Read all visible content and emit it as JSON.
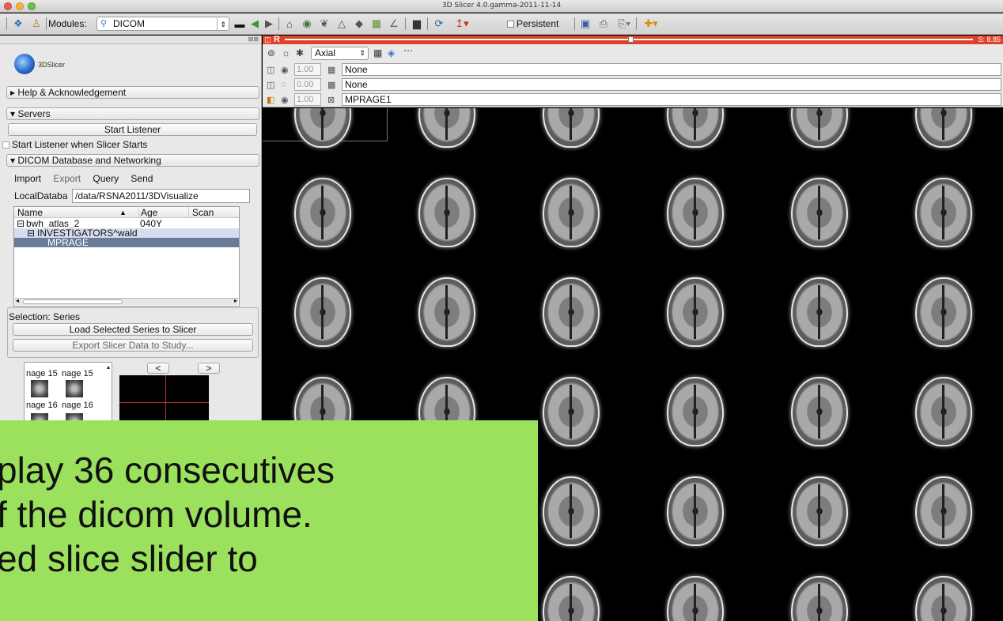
{
  "window": {
    "title": "3D Slicer 4.0.gamma-2011-11-14"
  },
  "toolbar": {
    "modules_label": "Modules:",
    "module_selected": "DICOM",
    "persistent_label": "Persistent"
  },
  "logo": {
    "text": "3DSlicer"
  },
  "sections": {
    "help": "Help & Acknowledgement",
    "servers": "Servers",
    "dicom_db": "DICOM Database and Networking"
  },
  "servers": {
    "start_listener": "Start Listener",
    "start_on_startup": "Start Listener when Slicer Starts"
  },
  "dicom": {
    "tabs": [
      "Import",
      "Export",
      "Query",
      "Send"
    ],
    "local_db_label": "LocalDataba",
    "local_db_path": "/data/RSNA2011/3DVisualize",
    "tree_columns": [
      "Name",
      "Age",
      "Scan"
    ],
    "tree_rows": [
      {
        "name": "bwh_atlas_2",
        "age": "040Y"
      },
      {
        "name": "INVESTIGATORS^wald",
        "age": ""
      },
      {
        "name": "MPRAGE",
        "age": ""
      }
    ],
    "selection_label": "Selection: Series",
    "load_button": "Load Selected Series to Slicer",
    "export_button": "Export Slicer Data to Study...",
    "thumb_labels": [
      "nage 15",
      "nage 15",
      "nage 16",
      "nage 16"
    ],
    "prev_label": "<",
    "next_label": ">"
  },
  "slice_controller": {
    "view_letter": "R",
    "offset_value": "S: 8.85",
    "orientation": "Axial",
    "layers": [
      {
        "opacity": "1.00",
        "volume": "None"
      },
      {
        "opacity": "0.00",
        "volume": "None"
      },
      {
        "opacity": "1.00",
        "volume": "MPRAGE1"
      }
    ]
  },
  "viewer": {
    "rows": 6,
    "cols": 6
  },
  "callout": {
    "lines": [
      "play 36 consecutives",
      "f the dicom volume.",
      "ed slice slider to"
    ]
  },
  "colors": {
    "slice_red": "#e0402a",
    "callout_green": "#9be15d",
    "selection_row": "#667c99"
  }
}
